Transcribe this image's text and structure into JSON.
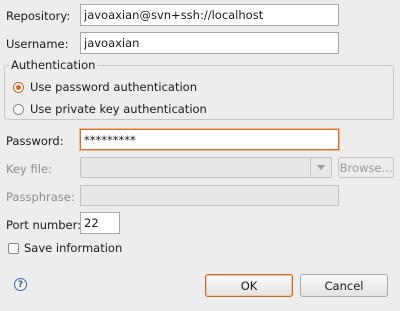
{
  "repository": {
    "label": "Repository:",
    "value": "javoaxian@svn+ssh://localhost"
  },
  "username": {
    "label": "Username:",
    "value": "javoaxian"
  },
  "authentication": {
    "legend": "Authentication",
    "options": [
      {
        "label": "Use password authentication",
        "checked": true
      },
      {
        "label": "Use private key authentication",
        "checked": false
      }
    ]
  },
  "password": {
    "label": "Password:",
    "value": "*********"
  },
  "key_file": {
    "label": "Key file:",
    "value": "",
    "browse_label": "Browse..."
  },
  "passphrase": {
    "label": "Passphrase:",
    "value": ""
  },
  "port": {
    "label": "Port number:",
    "value": "22"
  },
  "save_information": {
    "label": "Save information",
    "checked": false
  },
  "buttons": {
    "ok": "OK",
    "cancel": "Cancel"
  },
  "icons": {
    "help": "help-icon",
    "dropdown": "chevron-down-icon"
  },
  "colors": {
    "focus_accent": "#d2722f",
    "radio_checked": "#d4682a"
  }
}
